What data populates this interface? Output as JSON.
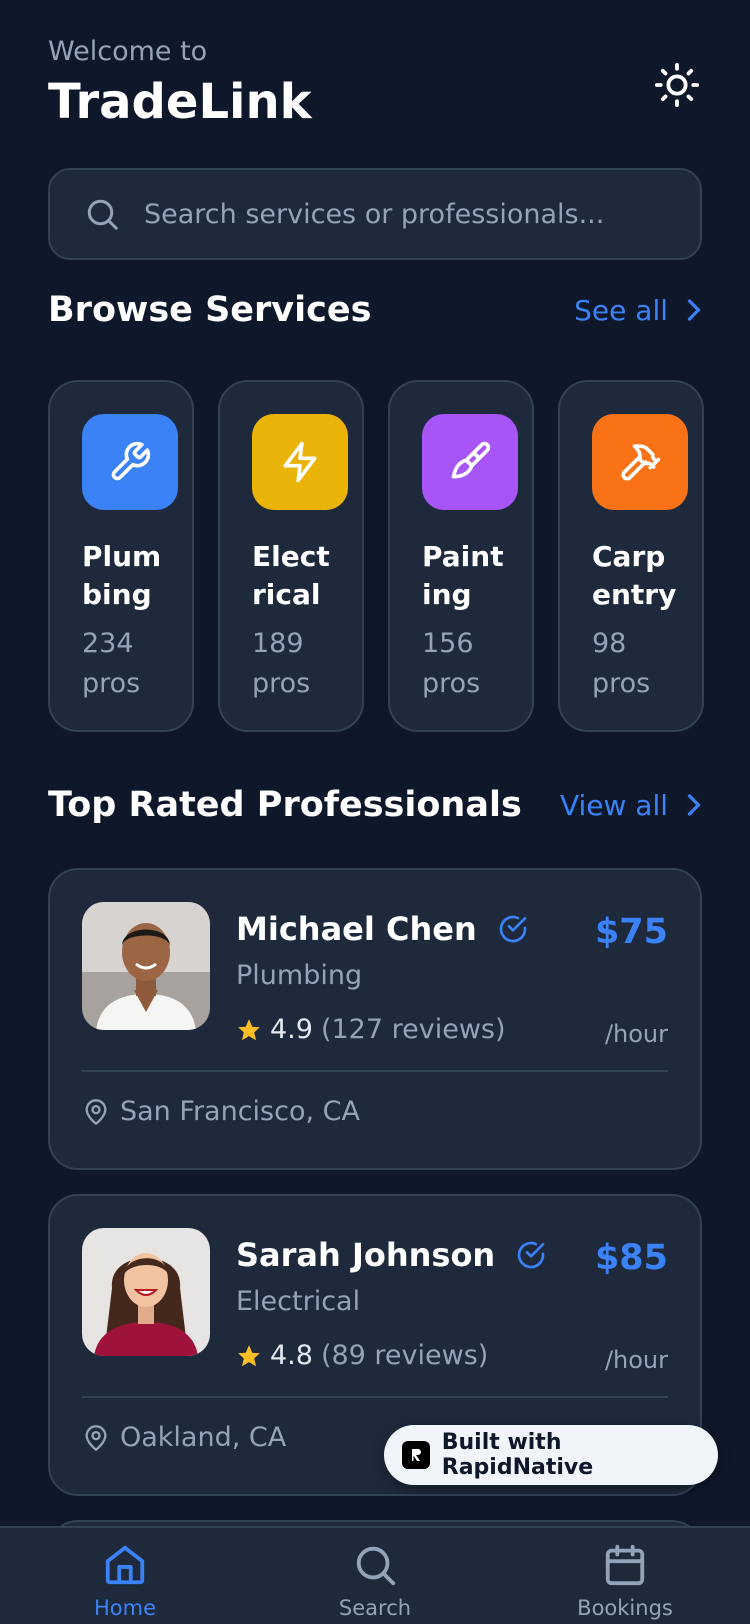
{
  "header": {
    "welcome": "Welcome to",
    "title": "TradeLink",
    "theme_icon": "sun-icon"
  },
  "search": {
    "placeholder": "Search services or professionals...",
    "icon": "search-icon"
  },
  "services_section": {
    "title": "Browse Services",
    "link": "See all",
    "items": [
      {
        "name": "Plumbing",
        "count": "234 pros",
        "icon": "wrench-icon",
        "color": "#3b82f6"
      },
      {
        "name": "Electrical",
        "count": "189 pros",
        "icon": "lightning-icon",
        "color": "#eab308"
      },
      {
        "name": "Painting",
        "count": "156 pros",
        "icon": "paintbrush-icon",
        "color": "#a855f7"
      },
      {
        "name": "Carpentry",
        "count": "98 pros",
        "icon": "hammer-icon",
        "color": "#f97316"
      }
    ]
  },
  "pros_section": {
    "title": "Top Rated Professionals",
    "link": "View all",
    "items": [
      {
        "name": "Michael Chen",
        "trade": "Plumbing",
        "rating": "4.9",
        "reviews": "(127 reviews)",
        "price": "$75",
        "unit": "/hour",
        "location": "San Francisco, CA"
      },
      {
        "name": "Sarah Johnson",
        "trade": "Electrical",
        "rating": "4.8",
        "reviews": "(89 reviews)",
        "price": "$85",
        "unit": "/hour",
        "location": "Oakland, CA"
      }
    ]
  },
  "badge": {
    "text": "Built with RapidNative"
  },
  "tabbar": {
    "tabs": [
      {
        "label": "Home",
        "icon": "home-icon",
        "active": true
      },
      {
        "label": "Search",
        "icon": "search-icon",
        "active": false
      },
      {
        "label": "Bookings",
        "icon": "calendar-icon",
        "active": false
      }
    ]
  },
  "colors": {
    "background": "#0f172a",
    "card": "#1e293b",
    "accent": "#3b82f6",
    "star": "#fbbf24"
  }
}
